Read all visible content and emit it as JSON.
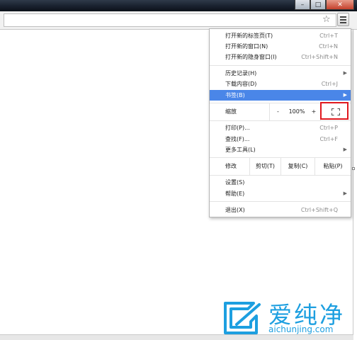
{
  "colors": {
    "accent": "#4a86e8",
    "highlight_box": "#e0181e",
    "logo": "#1d9fe0"
  },
  "window": {
    "minimize": "–",
    "restore": "□",
    "close": "✕"
  },
  "toolbar": {
    "star_icon": "star-icon",
    "menu_icon": "hamburger-menu-icon"
  },
  "menu": {
    "new_tab": {
      "label": "打开新的标签页(T)",
      "shortcut": "Ctrl+T"
    },
    "new_window": {
      "label": "打开新的窗口(N)",
      "shortcut": "Ctrl+N"
    },
    "new_incognito": {
      "label": "打开新的隐身窗口(I)",
      "shortcut": "Ctrl+Shift+N"
    },
    "history": {
      "label": "历史记录(H)"
    },
    "downloads": {
      "label": "下载内容(D)",
      "shortcut": "Ctrl+J"
    },
    "bookmarks": {
      "label": "书签(B)"
    },
    "zoom": {
      "label": "缩放",
      "minus": "-",
      "value": "100%",
      "plus": "+",
      "fullscreen_icon": "fullscreen-icon"
    },
    "print": {
      "label": "打印(P)...",
      "shortcut": "Ctrl+P"
    },
    "find": {
      "label": "查找(F)...",
      "shortcut": "Ctrl+F"
    },
    "more_tools": {
      "label": "更多工具(L)"
    },
    "edit": {
      "label": "修改",
      "cut": "剪切(T)",
      "copy": "复制(C)",
      "paste": "粘贴(P)"
    },
    "settings": {
      "label": "设置(S)"
    },
    "help": {
      "label": "帮助(E)"
    },
    "exit": {
      "label": "退出(X)",
      "shortcut": "Ctrl+Shift+Q"
    }
  },
  "watermark": {
    "chinese": "爱纯净",
    "url": "aichunjing.com"
  }
}
